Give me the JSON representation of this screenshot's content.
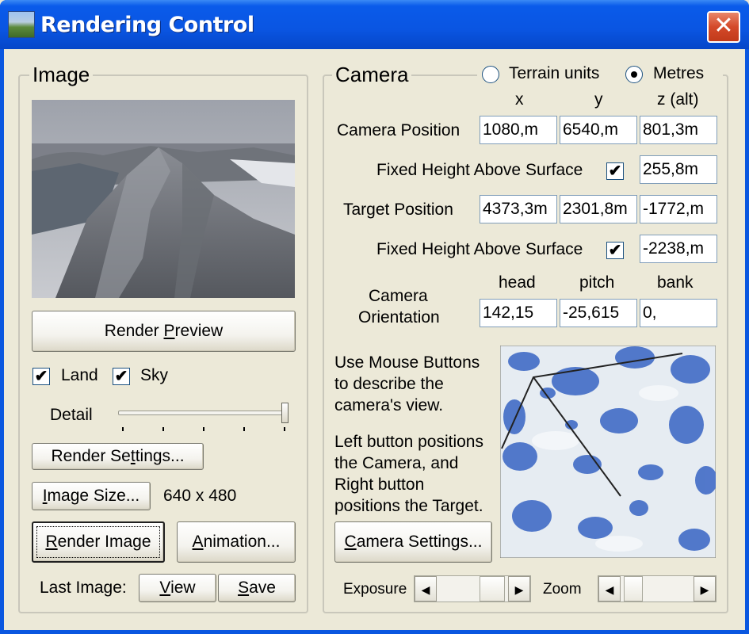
{
  "window": {
    "title": "Rendering Control",
    "close_glyph": "✕"
  },
  "image_group": {
    "label": "Image",
    "render_preview": {
      "before": "Render ",
      "underlined": "P",
      "after": "review"
    },
    "land_label": "Land",
    "land_checked": true,
    "sky_label": "Sky",
    "sky_checked": true,
    "detail_label": "Detail",
    "detail_level": 1.0,
    "render_settings": {
      "before": "Render Se",
      "underlined": "t",
      "after": "tings..."
    },
    "image_size": {
      "before": "",
      "underlined": "I",
      "after": "mage Size..."
    },
    "image_size_value": "640 x 480",
    "render_image": {
      "before": "",
      "underlined": "R",
      "after": "ender Image"
    },
    "animation": {
      "before": "",
      "underlined": "A",
      "after": "nimation..."
    },
    "last_image_label": "Last Image:",
    "view": {
      "before": "",
      "underlined": "V",
      "after": "iew"
    },
    "save": {
      "before": "",
      "underlined": "S",
      "after": "ave"
    }
  },
  "camera_group": {
    "label": "Camera",
    "unit_terrain": "Terrain units",
    "unit_metres": "Metres",
    "selected_unit": "Metres",
    "col_x": "x",
    "col_y": "y",
    "col_z": "z (alt)",
    "camera_position_label": "Camera Position",
    "camera_x": "1080,m",
    "camera_y": "6540,m",
    "camera_z": "801,3m",
    "fixed_height_label_1": "Fixed Height Above Surface",
    "fixed_height_1_checked": true,
    "fixed_height_1_value": "255,8m",
    "target_position_label": "Target Position",
    "target_x": "4373,3m",
    "target_y": "2301,8m",
    "target_z": "-1772,m",
    "fixed_height_label_2": "Fixed Height Above Surface",
    "fixed_height_2_checked": true,
    "fixed_height_2_value": "-2238,m",
    "col_head": "head",
    "col_pitch": "pitch",
    "col_bank": "bank",
    "orientation_label_1": "Camera",
    "orientation_label_2": "Orientation",
    "head": "142,15",
    "pitch": "-25,615",
    "bank": "0,",
    "help_1": [
      "Use Mouse Buttons",
      "to describe the",
      "camera's view."
    ],
    "help_2": [
      "Left button positions",
      "the Camera, and",
      "Right button",
      "positions the Target."
    ],
    "camera_settings": {
      "before": "",
      "underlined": "C",
      "after": "amera Settings..."
    },
    "exposure_label": "Exposure",
    "zoom_label": "Zoom",
    "left_arrow": "◀",
    "right_arrow": "▶"
  },
  "colors": {
    "titlebar": "#0A55E2",
    "face": "#ECE9D8",
    "map_water": "#4a72c8"
  }
}
